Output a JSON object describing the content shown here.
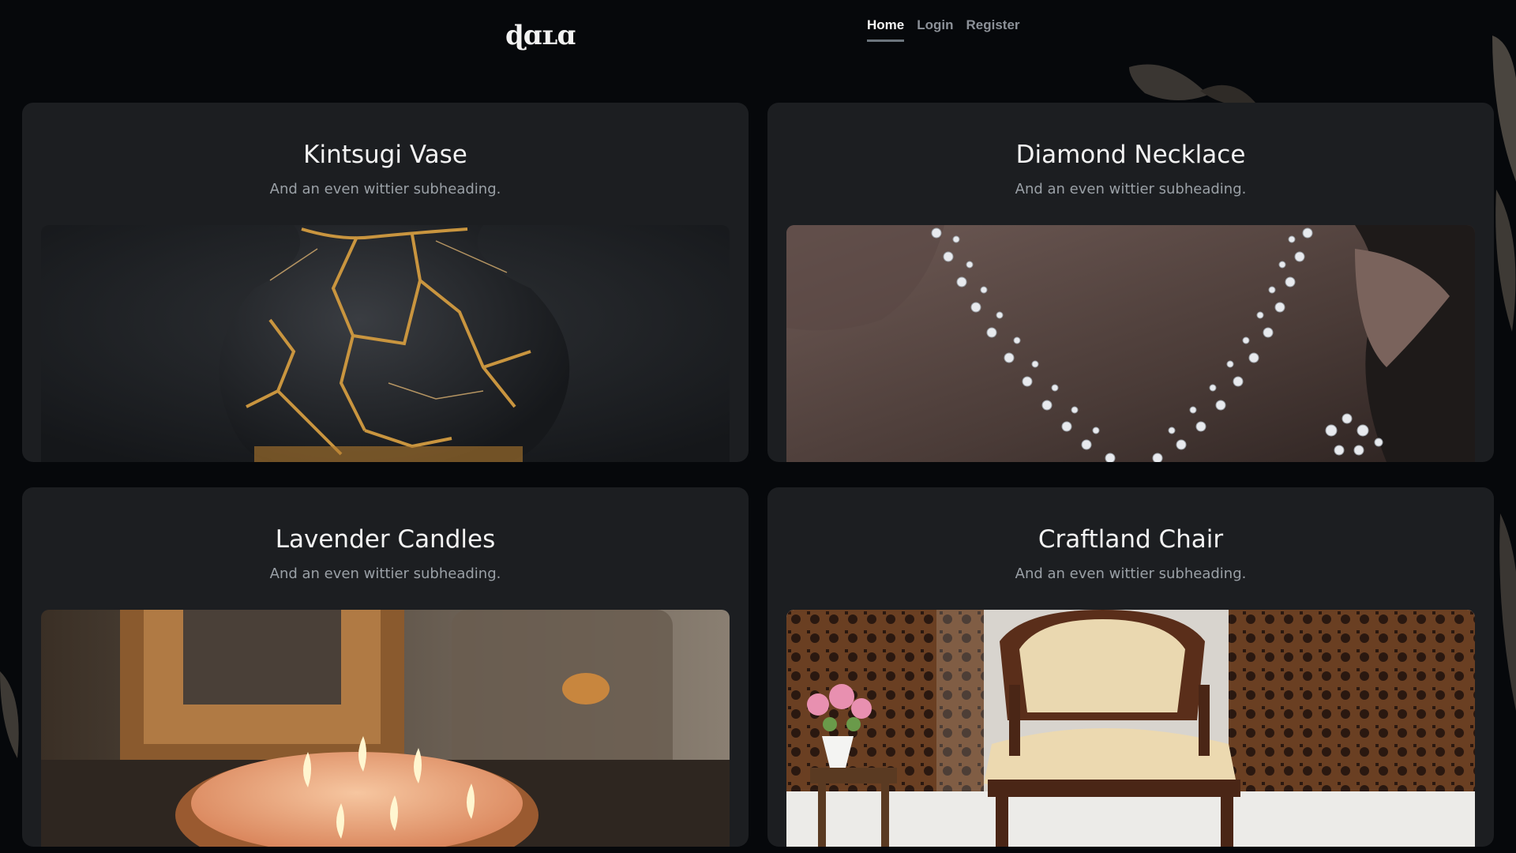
{
  "brand": {
    "logo_text": "ɖɑʟɑ"
  },
  "nav": {
    "items": [
      {
        "label": "Home",
        "active": true
      },
      {
        "label": "Login",
        "active": false
      },
      {
        "label": "Register",
        "active": false
      }
    ]
  },
  "products": [
    {
      "title": "Kintsugi Vase",
      "subheading": "And an even wittier subheading.",
      "image": "kintsugi-vase-photo"
    },
    {
      "title": "Diamond Necklace",
      "subheading": "And an even wittier subheading.",
      "image": "diamond-necklace-photo"
    },
    {
      "title": "Lavender Candles",
      "subheading": "And an even wittier subheading.",
      "image": "lavender-candles-photo"
    },
    {
      "title": "Craftland Chair",
      "subheading": "And an even wittier subheading.",
      "image": "craftland-chair-photo"
    }
  ],
  "colors": {
    "background": "#06080b",
    "card": "#1c1e21",
    "accent_gold": "#c9953f"
  }
}
